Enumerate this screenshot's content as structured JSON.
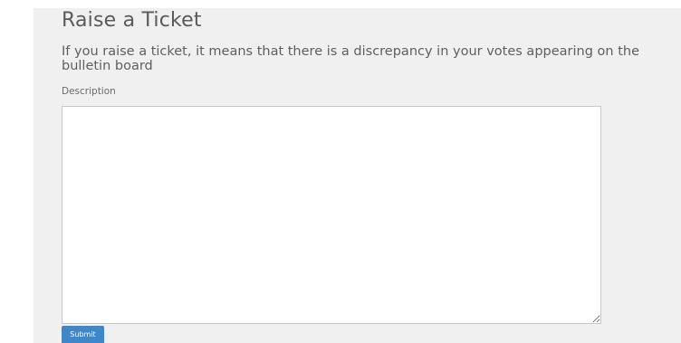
{
  "form": {
    "title": "Raise a Ticket",
    "subtitle": "If you raise a ticket, it means that there is a discrepancy in your votes appearing on the bulletin board",
    "description_label": "Description",
    "description_value": "",
    "submit_label": "Submit"
  },
  "colors": {
    "panel_bg": "#f0f0f0",
    "text": "#5a5a5a",
    "button_bg": "#3f87c9"
  }
}
